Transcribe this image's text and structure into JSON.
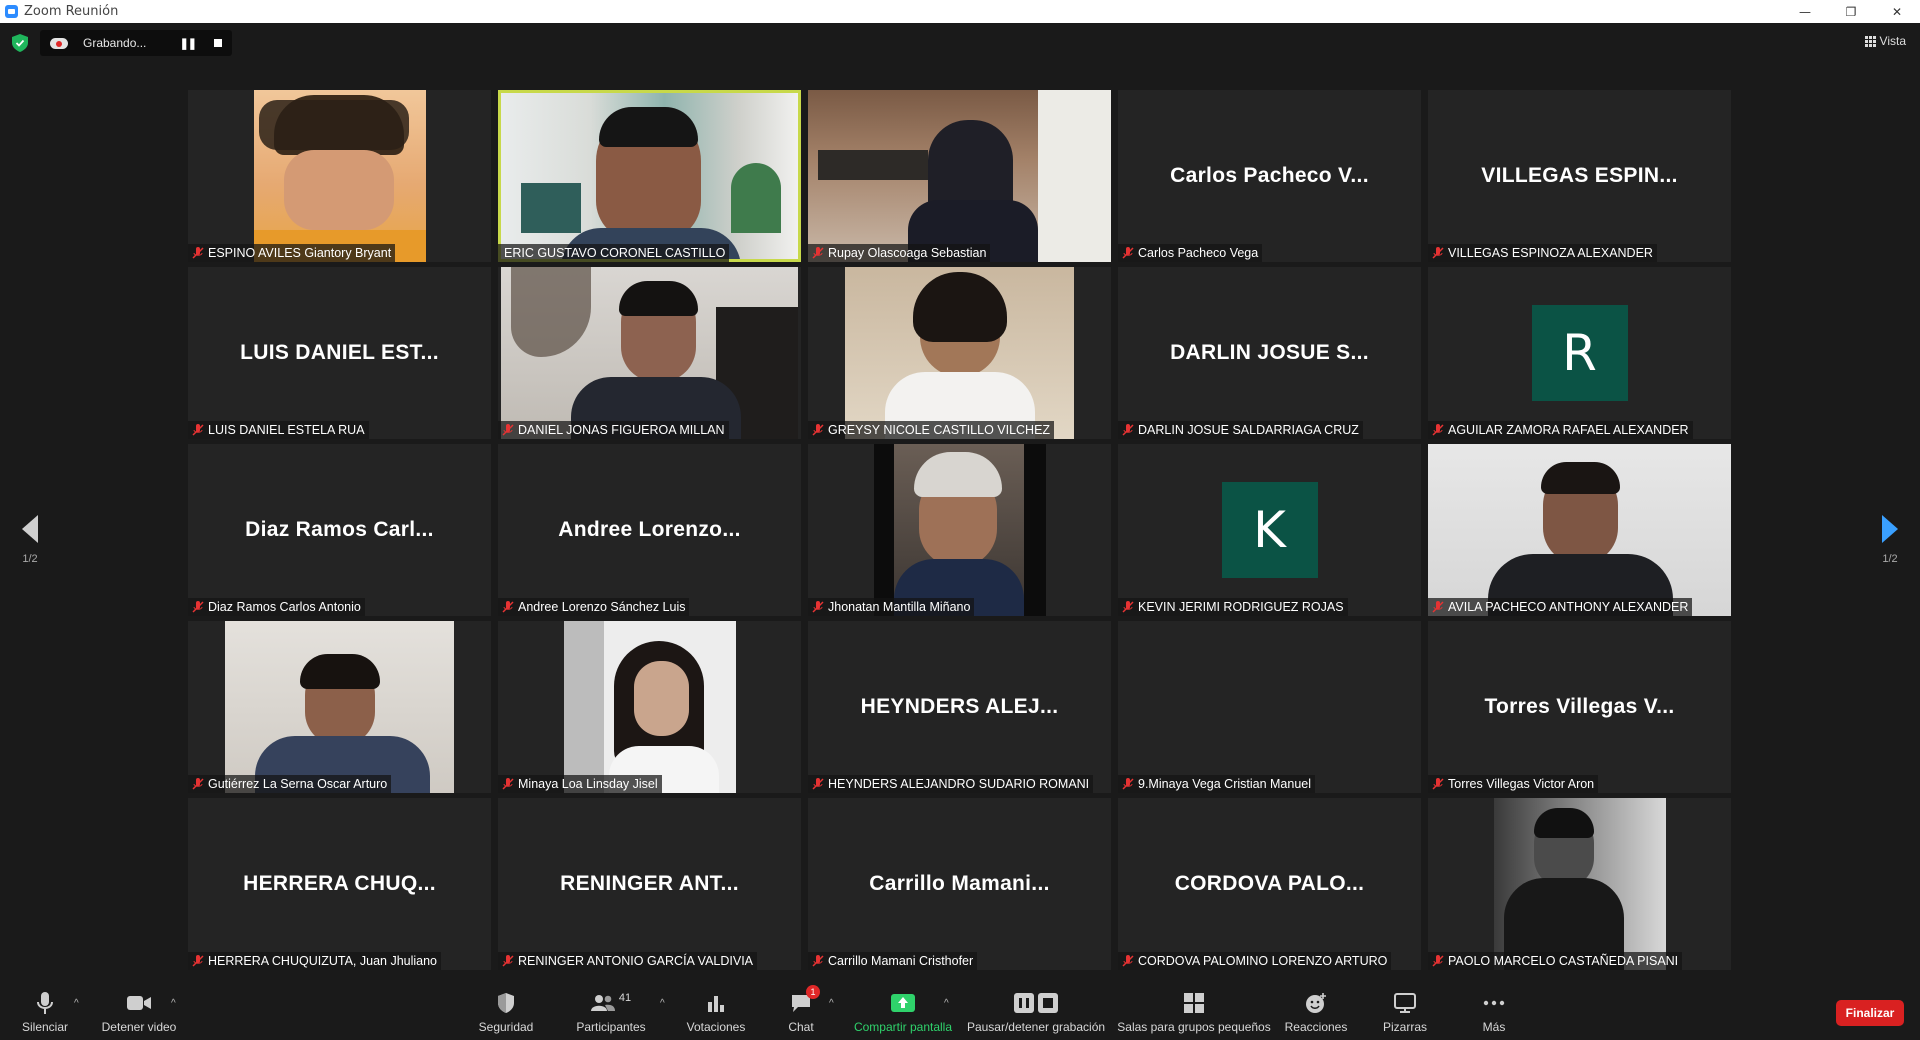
{
  "window": {
    "title": "Zoom Reunión",
    "minimize": "—",
    "restore": "❐",
    "close": "✕"
  },
  "recording": {
    "status": "Grabando..."
  },
  "view": {
    "label": "Vista"
  },
  "pager": {
    "left_label": "1/2",
    "right_label": "1/2"
  },
  "participants": [
    {
      "display": "ESPINO AVILES  Giantory Bryant",
      "big": "",
      "type": "video"
    },
    {
      "display": "ERIC GUSTAVO CORONEL CASTILLO",
      "big": "",
      "type": "video",
      "active": true
    },
    {
      "display": "Rupay Olascoaga Sebastian",
      "big": "",
      "type": "video"
    },
    {
      "display": "Carlos Pacheco Vega",
      "big": "Carlos Pacheco V...",
      "type": "name"
    },
    {
      "display": "VILLEGAS ESPINOZA ALEXANDER",
      "big": "VILLEGAS  ESPIN...",
      "type": "name"
    },
    {
      "display": "LUIS DANIEL ESTELA RUA",
      "big": "LUIS DANIEL EST...",
      "type": "name"
    },
    {
      "display": "DANIEL JONAS FIGUEROA MILLAN",
      "big": "",
      "type": "video"
    },
    {
      "display": "GREYSY NICOLE CASTILLO VILCHEZ",
      "big": "",
      "type": "video"
    },
    {
      "display": "DARLIN JOSUE SALDARRIAGA CRUZ",
      "big": "DARLIN JOSUE S...",
      "type": "name"
    },
    {
      "display": "AGUILAR ZAMORA RAFAEL ALEXANDER",
      "big": "R",
      "type": "avatar"
    },
    {
      "display": "Diaz Ramos Carlos Antonio",
      "big": "Diaz Ramos Carl...",
      "type": "name"
    },
    {
      "display": "Andree Lorenzo Sánchez Luis",
      "big": "Andree  Lorenzo...",
      "type": "name"
    },
    {
      "display": "Jhonatan Mantilla Miñano",
      "big": "",
      "type": "video"
    },
    {
      "display": "KEVIN JERIMI RODRIGUEZ ROJAS",
      "big": "K",
      "type": "avatar"
    },
    {
      "display": "AVILA PACHECO ANTHONY ALEXANDER",
      "big": "",
      "type": "video"
    },
    {
      "display": "Gutiérrez La Serna Oscar Arturo",
      "big": "",
      "type": "video"
    },
    {
      "display": "Minaya Loa Linsday Jisel",
      "big": "",
      "type": "video"
    },
    {
      "display": "HEYNDERS ALEJANDRO SUDARIO ROMANI",
      "big": "HEYNDERS  ALEJ...",
      "type": "name"
    },
    {
      "display": "9.Minaya Vega Cristian Manuel",
      "big": "",
      "type": "name"
    },
    {
      "display": "Torres Villegas Victor Aron",
      "big": "Torres Villegas V...",
      "type": "name"
    },
    {
      "display": "HERRERA CHUQUIZUTA, Juan Jhuliano",
      "big": "HERRERA  CHUQ...",
      "type": "name"
    },
    {
      "display": "RENINGER ANTONIO GARCÍA VALDIVIA",
      "big": "RENINGER  ANT...",
      "type": "name"
    },
    {
      "display": "Carrillo Mamani Cristhofer",
      "big": "Carrillo  Mamani...",
      "type": "name"
    },
    {
      "display": "CORDOVA PALOMINO LORENZO ARTURO",
      "big": "CORDOVA  PALO...",
      "type": "name"
    },
    {
      "display": "PAOLO MARCELO CASTAÑEDA PISANI",
      "big": "",
      "type": "video"
    }
  ],
  "toolbar": {
    "mute": "Silenciar",
    "video": "Detener video",
    "security": "Seguridad",
    "participants": "Participantes",
    "participants_count": "41",
    "polls": "Votaciones",
    "chat": "Chat",
    "chat_badge": "1",
    "share": "Compartir pantalla",
    "record": "Pausar/detener grabación",
    "breakout": "Salas para grupos pequeños",
    "reactions": "Reacciones",
    "whiteboards": "Pizarras",
    "more": "Más",
    "end": "Finalizar"
  },
  "colors": {
    "accent_green": "#2fd26b",
    "active_border": "#c8d94a",
    "end_red": "#d92121",
    "avatar_bg": "#0b5345"
  }
}
